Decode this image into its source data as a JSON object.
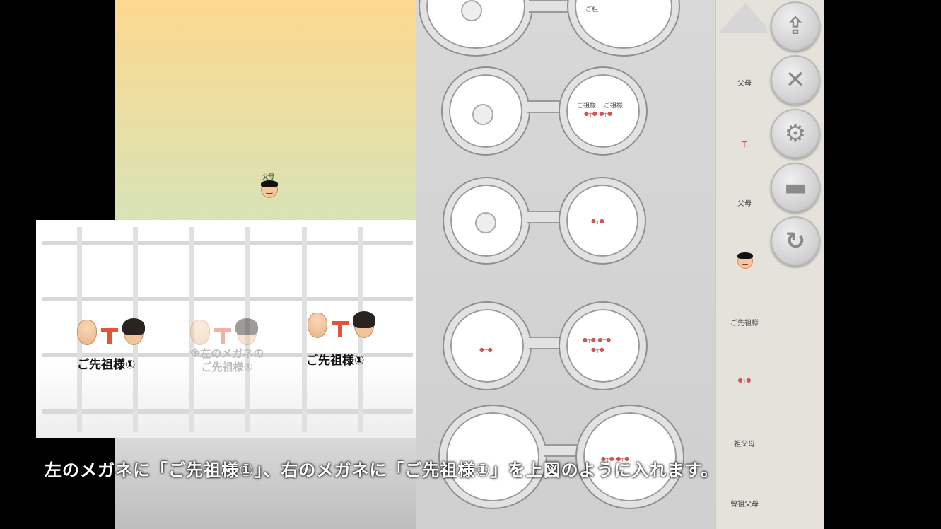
{
  "field": {
    "character_label": "父母"
  },
  "grid_panel": {
    "left_label": "ご先祖様①",
    "middle_label_line1": "※左のメガネの",
    "middle_label_line2": "ご先祖様①",
    "right_label": "ご先祖様①"
  },
  "glasses": {
    "top_right_label": "ご祖",
    "row2_right_label_a": "ご祖様",
    "row2_right_label_b": "ご祖様"
  },
  "palette": {
    "items": [
      "父母",
      "父母",
      "ご先祖様",
      "祖父母",
      "曾祖父母"
    ]
  },
  "buttons": {
    "exit_icon": "exit-icon",
    "close_icon": "close-icon",
    "settings_icon": "gear-icon",
    "blank_icon": "square-icon",
    "undo_icon": "undo-icon"
  },
  "caption": {
    "text": "左のメガネに「ご先祖様①」、右のメガネに「ご先祖様①」を上図のように入れます。"
  },
  "colors": {
    "sky_top": "#fdd88f",
    "sky_bottom": "#b8e6f5",
    "link_red": "#e2533a"
  }
}
